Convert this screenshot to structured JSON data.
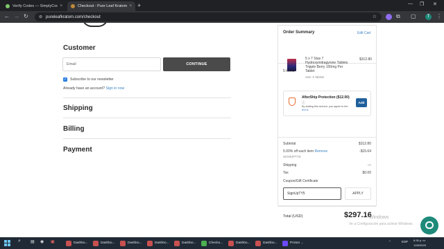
{
  "browser": {
    "tabs": [
      {
        "title": "Verify Codes — SimplyCodes",
        "close": "×"
      },
      {
        "title": "Checkout - Pure Leaf Kratom",
        "close": "×"
      }
    ],
    "new_tab": "+",
    "url": "pureleafkratom.com/checkout",
    "window_controls": [
      "—",
      "❐",
      "✕"
    ],
    "profile_initial": "T"
  },
  "checkout": {
    "customer_title": "Customer",
    "email_placeholder": "Email",
    "continue_label": "CONTINUE",
    "newsletter_label": "Subscribe to our newsletter",
    "account_prompt": "Already have an account?",
    "sign_in_link": "Sign in now",
    "shipping_title": "Shipping",
    "billing_title": "Billing",
    "payment_title": "Payment"
  },
  "order_summary": {
    "title": "Order Summary",
    "edit_cart": "Edit Cart",
    "items_count": "5 Items",
    "product": {
      "name": "5 x 7 Stax 7 Hydroxymitragynine Tablets Tripple Berry 100mg Per Tablet",
      "price": "$312.80",
      "sub": "Size: 5 Tablets"
    },
    "aftership": {
      "title": "AfterShip Protection ($12.00)",
      "info_icon": "ⓘ",
      "description": "By adding this service, you agree to the",
      "terms_link": "terms",
      "add_label": "Add"
    },
    "rows": {
      "subtotal_label": "Subtotal",
      "subtotal_value": "$312.80",
      "discount_label": "5.00% off each item",
      "remove_label": "Remove",
      "discount_value": "-$15.64",
      "discount_code": "SIGNUPTY5",
      "shipping_label": "Shipping",
      "shipping_value": "—",
      "tax_label": "Tax",
      "tax_value": "$0.00"
    },
    "coupon_link": "Coupon/Gift Certificate",
    "coupon_value": "SignUpTY5",
    "apply_label": "APPLY",
    "total_label": "Total (USD)",
    "total_value": "$297.16"
  },
  "watermark": {
    "line1": "Windows",
    "line2": "Ve a Configuración para activar Windows."
  },
  "taskbar": {
    "items": [
      "Dashbo...",
      "Dashbo...",
      "Dashbo...",
      "Dashbo...",
      "Dashbo...",
      "Checko...",
      "Dashbo...",
      "Dashbo...",
      "Proton ..."
    ],
    "lang": "ESP",
    "time": "6:39 p. m.",
    "date": "12/8/2025"
  },
  "colors": {
    "accent_link": "#3b82c4",
    "continue_bg": "#4a4a4a",
    "add_button": "#1f5f9c",
    "aftership_orange": "#e36b2c",
    "chat_teal": "#1e8a7a"
  }
}
